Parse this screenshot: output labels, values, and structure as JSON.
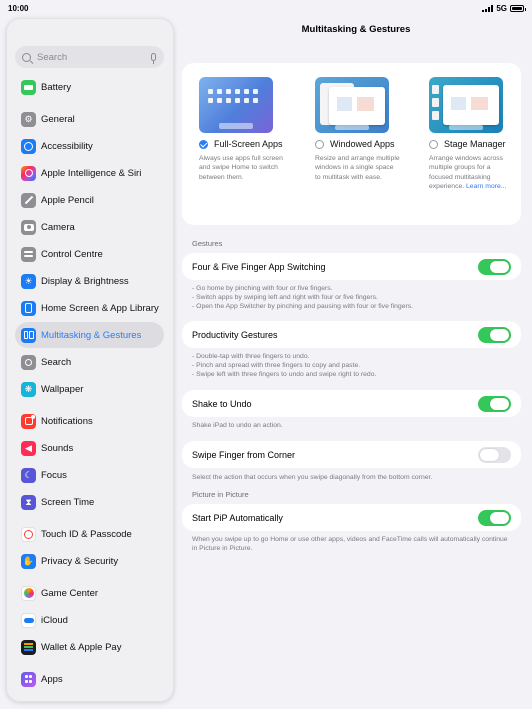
{
  "status": {
    "time": "10:00",
    "network": "5G"
  },
  "sidebar": {
    "search_placeholder": "Search",
    "items": [
      {
        "label": "Battery",
        "icon": "battery-icon",
        "color": "#34c759"
      },
      {
        "label": "General",
        "icon": "gear-icon",
        "color": "#8e8e93"
      },
      {
        "label": "Accessibility",
        "icon": "accessibility-icon",
        "color": "#1b7cf5"
      },
      {
        "label": "Apple Intelligence & Siri",
        "icon": "siri-icon",
        "color": "#e5396b"
      },
      {
        "label": "Apple Pencil",
        "icon": "pencil-icon",
        "color": "#8e8e93"
      },
      {
        "label": "Camera",
        "icon": "camera-icon",
        "color": "#8e8e93"
      },
      {
        "label": "Control Centre",
        "icon": "control-centre-icon",
        "color": "#8e8e93"
      },
      {
        "label": "Display & Brightness",
        "icon": "sun-icon",
        "color": "#1b7cf5"
      },
      {
        "label": "Home Screen & App Library",
        "icon": "home-screen-icon",
        "color": "#1b7cf5"
      },
      {
        "label": "Multitasking & Gestures",
        "icon": "multitasking-icon",
        "color": "#1b7cf5"
      },
      {
        "label": "Search",
        "icon": "search-icon",
        "color": "#8e8e93"
      },
      {
        "label": "Wallpaper",
        "icon": "wallpaper-icon",
        "color": "#14b5d8"
      },
      {
        "label": "Notifications",
        "icon": "bell-icon",
        "color": "#ff3b30"
      },
      {
        "label": "Sounds",
        "icon": "speaker-icon",
        "color": "#ff2d55"
      },
      {
        "label": "Focus",
        "icon": "moon-icon",
        "color": "#5856d6"
      },
      {
        "label": "Screen Time",
        "icon": "hourglass-icon",
        "color": "#5856d6"
      },
      {
        "label": "Touch ID & Passcode",
        "icon": "fingerprint-icon",
        "color": "#ff3b30"
      },
      {
        "label": "Privacy & Security",
        "icon": "hand-icon",
        "color": "#1b7cf5"
      },
      {
        "label": "Game Center",
        "icon": "game-center-icon",
        "color": "#ff9500"
      },
      {
        "label": "iCloud",
        "icon": "cloud-icon",
        "color": "#1b7cf5"
      },
      {
        "label": "Wallet & Apple Pay",
        "icon": "wallet-icon",
        "color": "#1c1c1e"
      },
      {
        "label": "Apps",
        "icon": "apps-icon",
        "color": "#5856d6"
      }
    ]
  },
  "main": {
    "title": "Multitasking & Gestures",
    "modes": [
      {
        "label": "Full-Screen Apps",
        "selected": true,
        "description": "Always use apps full screen and swipe Home to switch between them."
      },
      {
        "label": "Windowed Apps",
        "selected": false,
        "description": "Resize and arrange multiple windows in a single space to multitask with ease."
      },
      {
        "label": "Stage Manager",
        "selected": false,
        "description": "Arrange windows across multiple groups for a focused multitasking experience.",
        "link": "Learn more..."
      }
    ],
    "gestures_header": "Gestures",
    "four_five": {
      "label": "Four & Five Finger App Switching",
      "on": true,
      "footer": [
        "- Go home by pinching with four or five fingers.",
        "- Switch apps by swiping left and right with four or five fingers.",
        "- Open the App Switcher by pinching and pausing with four or five fingers."
      ]
    },
    "productivity": {
      "label": "Productivity Gestures",
      "on": true,
      "footer": [
        "- Double-tap with three fingers to undo.",
        "- Pinch and spread with three fingers to copy and paste.",
        "- Swipe left with three fingers to undo and swipe right to redo."
      ]
    },
    "shake": {
      "label": "Shake to Undo",
      "on": true,
      "footer": "Shake iPad to undo an action."
    },
    "swipe_corner": {
      "label": "Swipe Finger from Corner",
      "on": false,
      "footer": "Select the action that occurs when you swipe diagonally from the bottom corner."
    },
    "pip_header": "Picture in Picture",
    "pip": {
      "label": "Start PiP Automatically",
      "on": true,
      "footer": "When you swipe up to go Home or use other apps, videos and FaceTime calls will automatically continue in Picture in Picture."
    }
  }
}
